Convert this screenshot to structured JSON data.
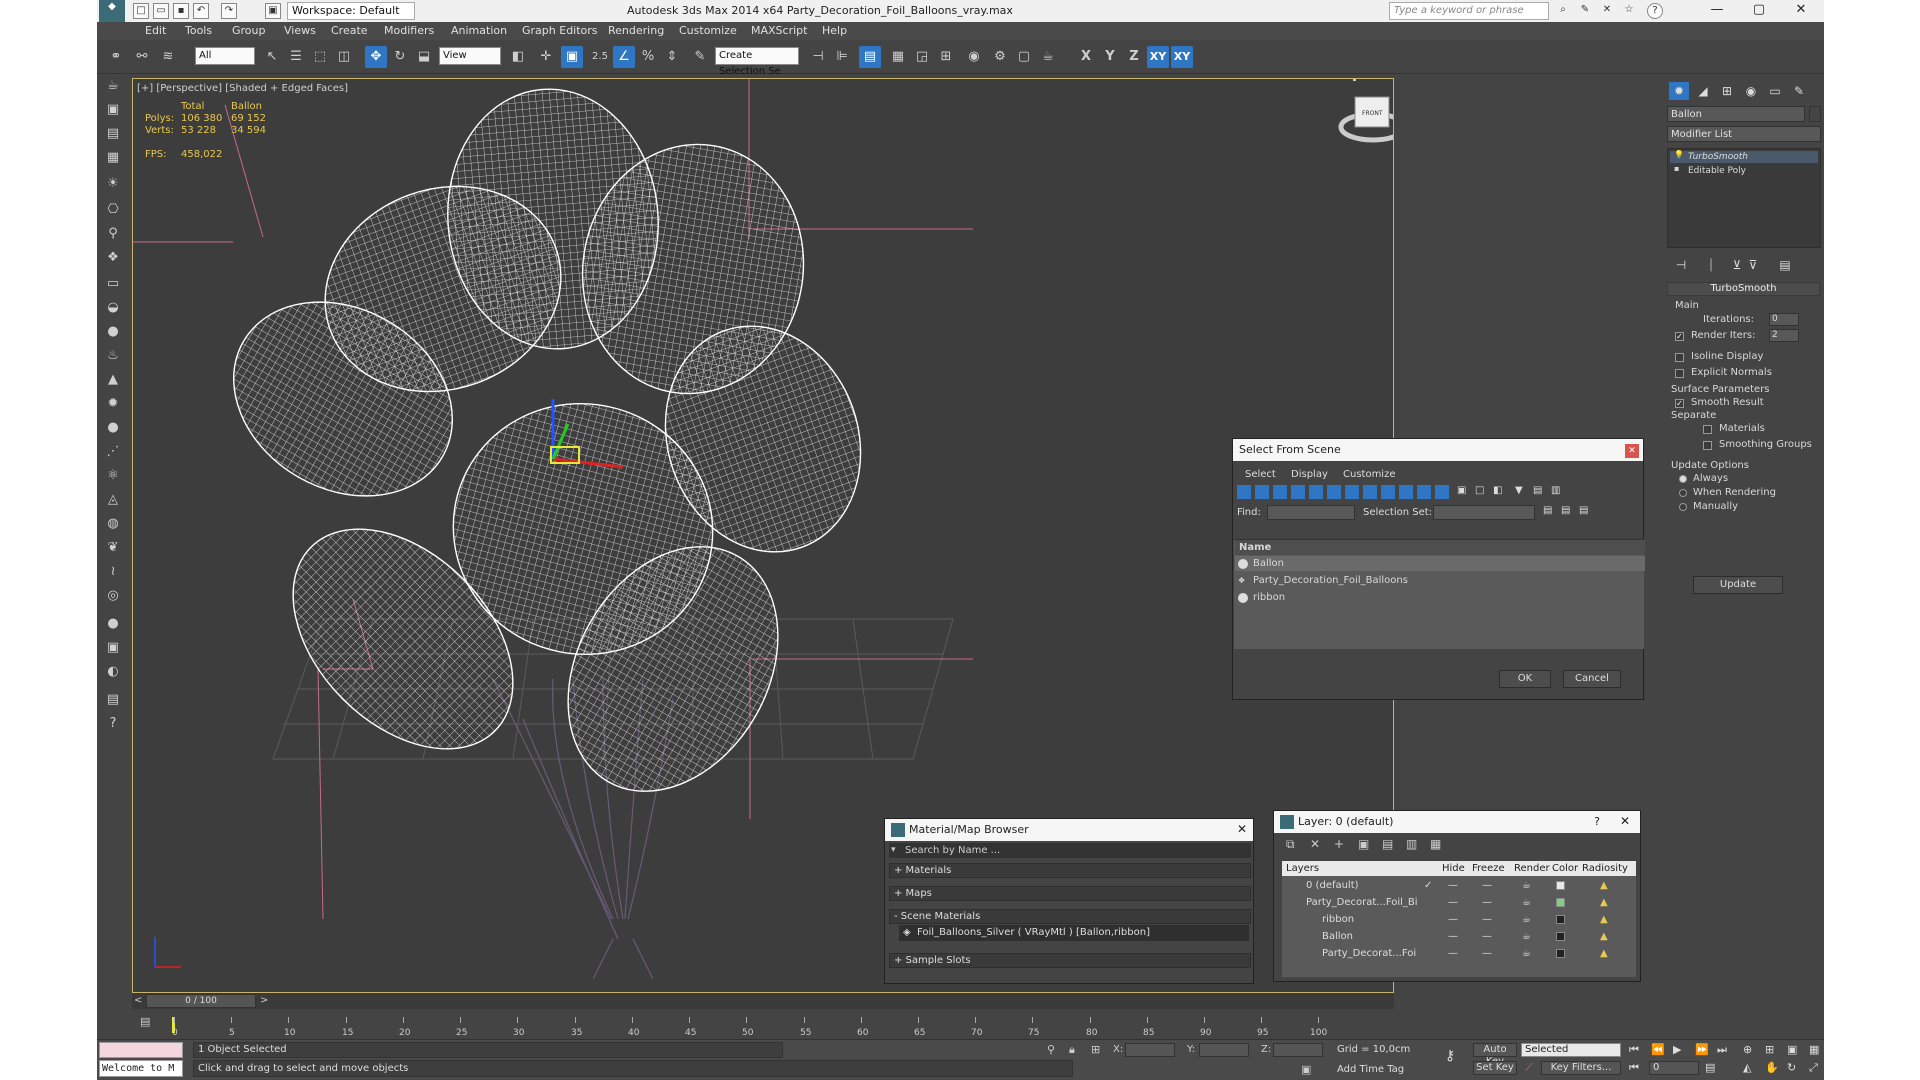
{
  "titlebar": {
    "workspace": "Workspace: Default",
    "title": "Autodesk 3ds Max  2014 x64     Party_Decoration_Foil_Balloons_vray.max",
    "search_placeholder": "Type a keyword or phrase"
  },
  "menu": [
    "Edit",
    "Tools",
    "Group",
    "Views",
    "Create",
    "Modifiers",
    "Animation",
    "Graph Editors",
    "Rendering",
    "Customize",
    "MAXScript",
    "Help"
  ],
  "toolbar": {
    "selection_filter": "All",
    "ref_coord": "View",
    "named_selection": "Create Selection Se",
    "axis": [
      "X",
      "Y",
      "Z",
      "XY",
      "XY"
    ],
    "snap_label": "2.5"
  },
  "viewport": {
    "label": "[+] [Perspective] [Shaded + Edged Faces]",
    "stats": {
      "col_total": "Total",
      "col_obj": "Ballon",
      "polys_label": "Polys:",
      "polys_total": "106 380",
      "polys_obj": "69 152",
      "verts_label": "Verts:",
      "verts_total": "53 228",
      "verts_obj": "34 594",
      "fps_label": "FPS:",
      "fps_value": "458,022"
    },
    "viewcube_label": "FRONT"
  },
  "command_panel": {
    "object_name": "Ballon",
    "modifier_list": "Modifier List",
    "stack": [
      "TurboSmooth",
      "Editable Poly"
    ],
    "turbosmooth": {
      "header": "TurboSmooth",
      "main": "Main",
      "iterations_label": "Iterations:",
      "iterations": "0",
      "render_iters_label": "Render Iters:",
      "render_iters": "2",
      "isoline": "Isoline Display",
      "explicit_normals": "Explicit Normals",
      "surface_params": "Surface Parameters",
      "smooth_result": "Smooth Result",
      "separate": "Separate",
      "materials": "Materials",
      "smoothing_groups": "Smoothing Groups",
      "update_options": "Update Options",
      "always": "Always",
      "when_rendering": "When Rendering",
      "manually": "Manually",
      "update_button": "Update"
    }
  },
  "select_dialog": {
    "title": "Select From Scene",
    "menus": [
      "Select",
      "Display",
      "Customize"
    ],
    "find_label": "Find:",
    "selection_set_label": "Selection Set:",
    "column_name": "Name",
    "items": [
      "Ballon",
      "Party_Decoration_Foil_Balloons",
      "ribbon"
    ],
    "ok": "OK",
    "cancel": "Cancel"
  },
  "material_browser": {
    "title": "Material/Map Browser",
    "search_placeholder": "Search by Name ...",
    "sections": [
      "+ Materials",
      "+ Maps",
      "- Scene Materials",
      "+ Sample Slots"
    ],
    "scene_material": "Foil_Balloons_Silver ( VRayMtl ) [Ballon,ribbon]"
  },
  "layer_dialog": {
    "title": "Layer: 0 (default)",
    "columns": [
      "Layers",
      "Hide",
      "Freeze",
      "Render",
      "Color",
      "Radiosity"
    ],
    "rows": [
      {
        "name": "0 (default)",
        "color": "#e8e8e8"
      },
      {
        "name": "Party_Decorat...Foil_Bi",
        "color": "#7fd07f"
      },
      {
        "name": "ribbon",
        "color": "#222222"
      },
      {
        "name": "Ballon",
        "color": "#222222"
      },
      {
        "name": "Party_Decorat...Foi",
        "color": "#222222"
      }
    ]
  },
  "timeline": {
    "frame": "0 / 100",
    "ticks": [
      "0",
      "5",
      "10",
      "15",
      "20",
      "25",
      "30",
      "35",
      "40",
      "45",
      "50",
      "55",
      "60",
      "65",
      "70",
      "75",
      "80",
      "85",
      "90",
      "95",
      "100"
    ]
  },
  "status": {
    "maxscript": "Welcome to M",
    "selected": "1 Object Selected",
    "prompt": "Click and drag to select and move objects",
    "x_label": "X:",
    "y_label": "Y:",
    "z_label": "Z:",
    "grid": "Grid = 10,0cm",
    "add_time_tag": "Add Time Tag",
    "auto_key": "Auto Key",
    "set_key": "Set Key",
    "key_mode": "Selected",
    "key_filters": "Key Filters...",
    "current_frame": "0"
  }
}
